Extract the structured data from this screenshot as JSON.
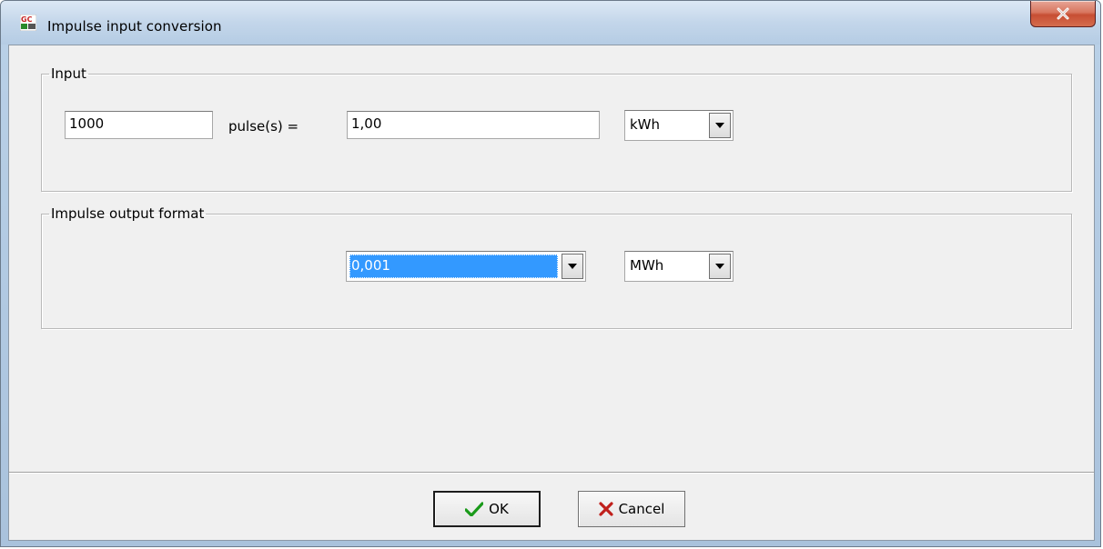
{
  "window": {
    "title": "Impulse input conversion",
    "close_label": "x",
    "icon": "gc-app-icon"
  },
  "input_group": {
    "legend": "Input",
    "pulses_value": "1000",
    "pulses_label": "pulse(s) =",
    "amount_value": "1,00",
    "unit_selected": "kWh"
  },
  "output_group": {
    "legend": "Impulse output format",
    "format_selected": "0,001",
    "unit_selected": "MWh"
  },
  "buttons": {
    "ok_label": "OK",
    "cancel_label": "Cancel"
  },
  "colors": {
    "selection": "#3399ff",
    "ok_check": "#1a9a1a",
    "cancel_x": "#c0201c"
  }
}
